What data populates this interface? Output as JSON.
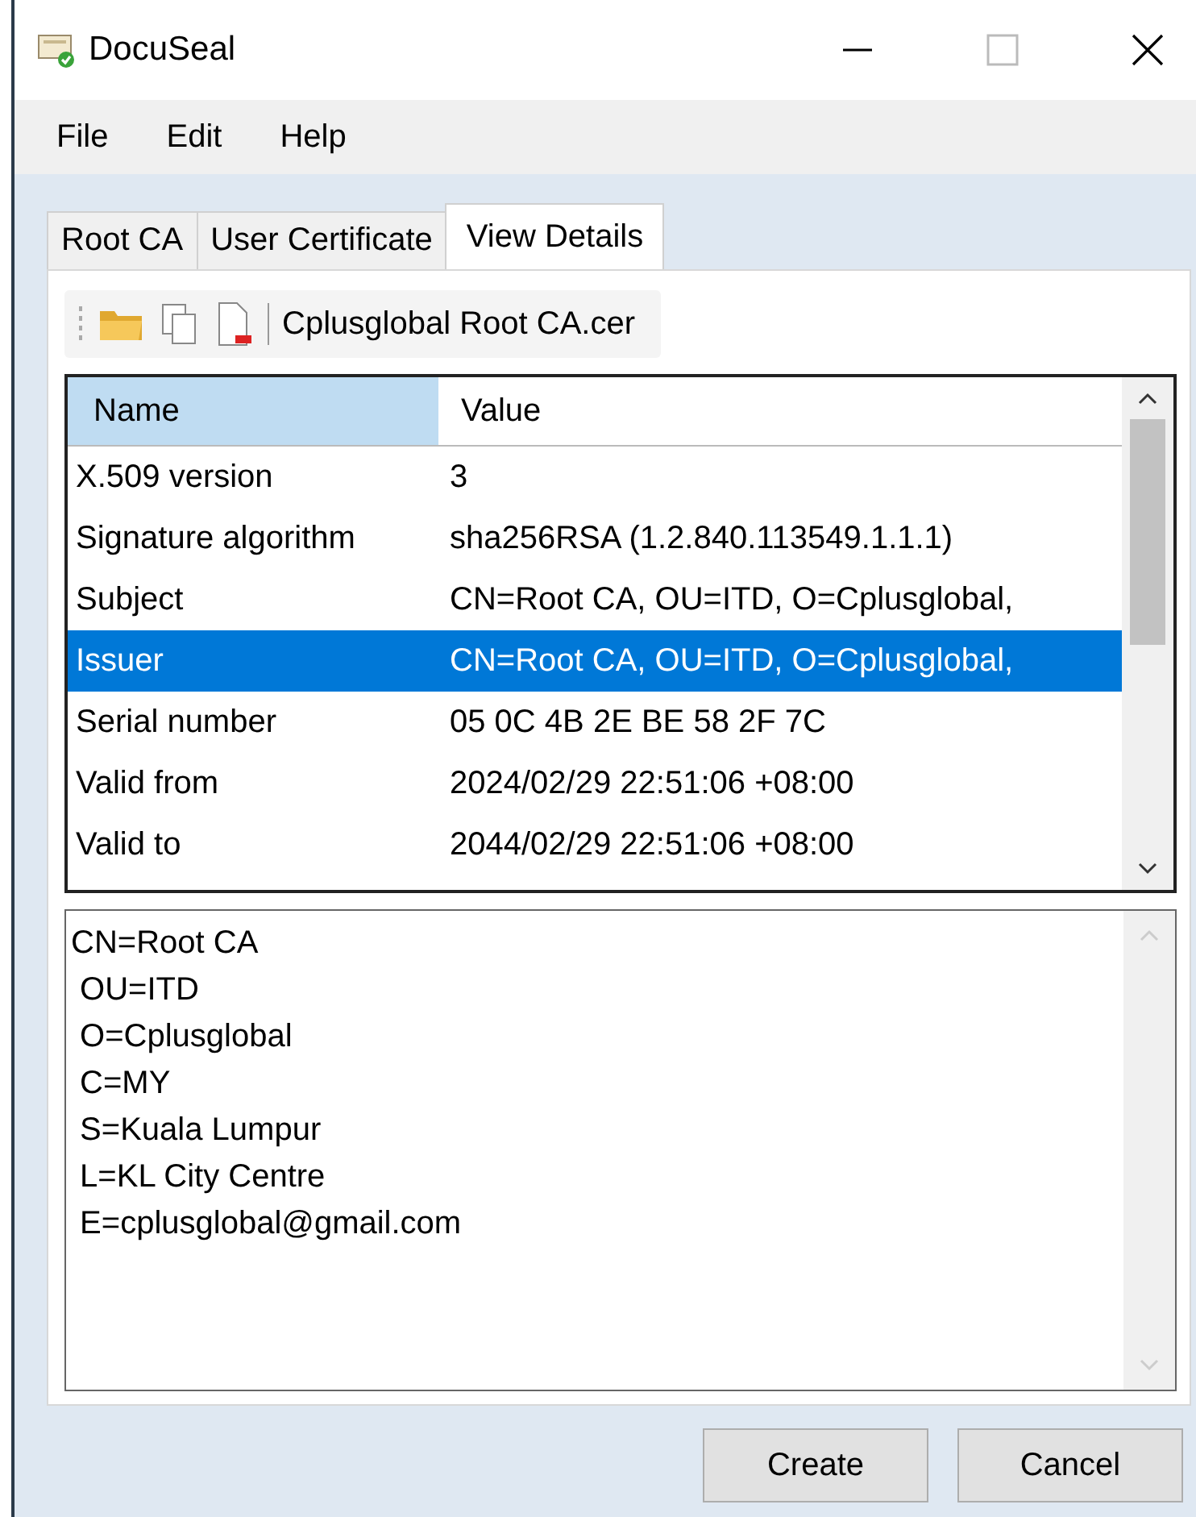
{
  "window": {
    "title": "DocuSeal"
  },
  "menu": [
    "File",
    "Edit",
    "Help"
  ],
  "tabs": [
    {
      "label": "Root CA",
      "selected": false
    },
    {
      "label": "User Certificate",
      "selected": false
    },
    {
      "label": "View Details",
      "selected": true
    }
  ],
  "toolbar": {
    "file_name": "Cplusglobal Root CA.cer"
  },
  "table": {
    "columns": [
      "Name",
      "Value"
    ],
    "rows": [
      {
        "name": "X.509 version",
        "value": "3",
        "selected": false
      },
      {
        "name": "Signature algorithm",
        "value": "sha256RSA (1.2.840.113549.1.1.1)",
        "selected": false
      },
      {
        "name": "Subject",
        "value": "CN=Root CA, OU=ITD, O=Cplusglobal,",
        "selected": false
      },
      {
        "name": "Issuer",
        "value": "CN=Root CA, OU=ITD, O=Cplusglobal,",
        "selected": true
      },
      {
        "name": "Serial number",
        "value": "05 0C 4B 2E BE 58 2F 7C",
        "selected": false
      },
      {
        "name": "Valid from",
        "value": "2024/02/29 22:51:06 +08:00",
        "selected": false
      },
      {
        "name": "Valid to",
        "value": "2044/02/29 22:51:06 +08:00",
        "selected": false
      }
    ]
  },
  "details": [
    "CN=Root CA",
    " OU=ITD",
    " O=Cplusglobal",
    " C=MY",
    " S=Kuala Lumpur",
    " L=KL City Centre",
    " E=cplusglobal@gmail.com"
  ],
  "buttons": [
    "Create",
    "Cancel"
  ]
}
